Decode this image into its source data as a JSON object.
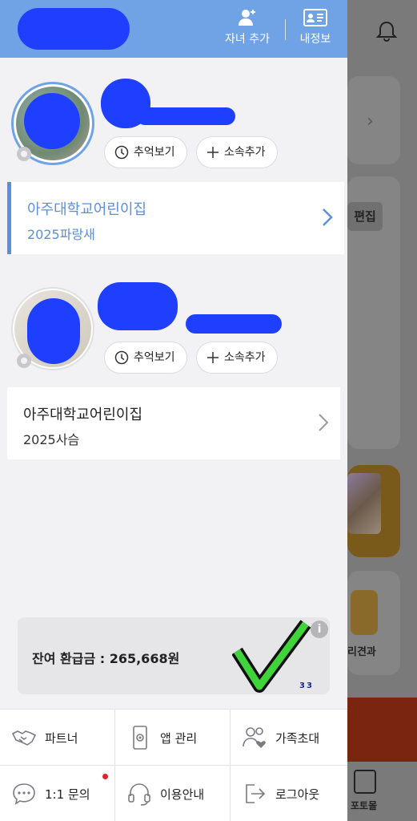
{
  "header": {
    "add_child_label": "자녀 추가",
    "my_info_label": "내정보"
  },
  "children": [
    {
      "avatar_icon": "child-photo",
      "memories_label": "추억보기",
      "add_affiliation_label": "소속추가",
      "school": "아주대학교어린이집",
      "class": "2025파랑새",
      "selected": true
    },
    {
      "avatar_icon": "child-photo",
      "memories_label": "추억보기",
      "add_affiliation_label": "소속추가",
      "school": "아주대학교어린이집",
      "class": "2025사슴",
      "selected": false
    }
  ],
  "refund": {
    "text": "잔여 환급금 : 265,668원",
    "mark_number": "33"
  },
  "menu": [
    {
      "label": "파트너",
      "icon": "handshake-icon"
    },
    {
      "label": "앱 관리",
      "icon": "phone-settings-icon"
    },
    {
      "label": "가족초대",
      "icon": "family-invite-icon"
    },
    {
      "label": "1:1 문의",
      "icon": "chat-icon",
      "badge": true
    },
    {
      "label": "이용안내",
      "icon": "headset-icon"
    },
    {
      "label": "로그아웃",
      "icon": "logout-icon"
    }
  ],
  "background": {
    "edit_label": "편집",
    "card_label": "리견과",
    "photo_tab_label": "포토몰"
  },
  "colors": {
    "header": "#6fa3e6",
    "selected_accent": "#5b8fd6",
    "redaction": "#1f3fff",
    "checkmark": "#3fd43a",
    "badge": "#e0242a"
  }
}
